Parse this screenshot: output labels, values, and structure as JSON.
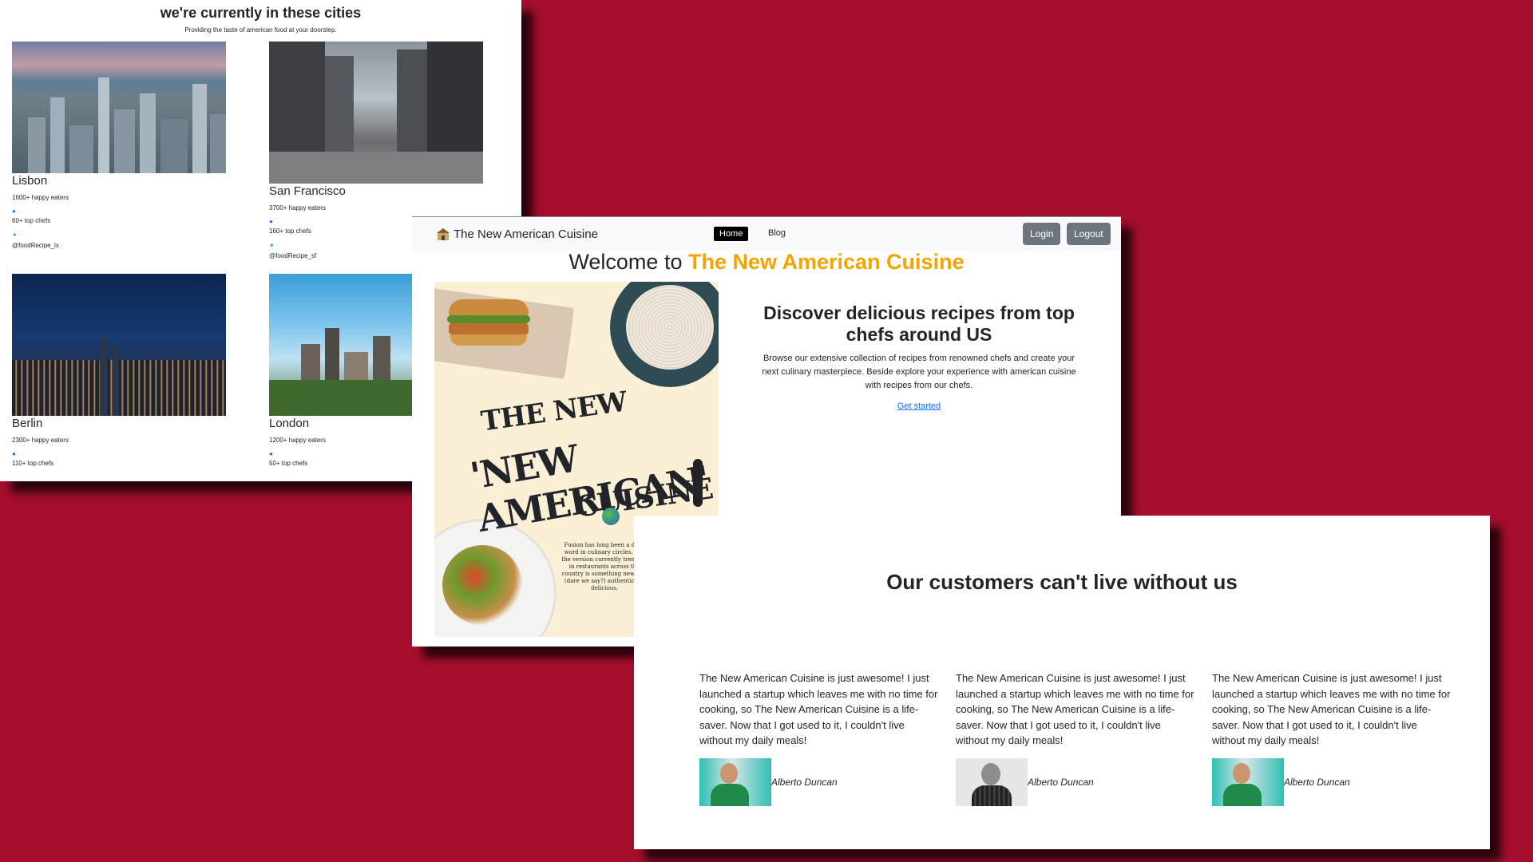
{
  "cities_section": {
    "title": "we're currently in these cities",
    "subtitle": "Providing the taste of american food at your doorstep.",
    "cities": [
      {
        "name": "Lisbon",
        "eaters": "1600+ happy eaters",
        "chefs": "60+ top chefs",
        "handle": "@foodRecipe_lx"
      },
      {
        "name": "San Francisco",
        "eaters": "3700+ happy eaters",
        "chefs": "160+ top chefs",
        "handle": "@foodRecipe_sf"
      },
      {
        "name": "Berlin",
        "eaters": "2300+ happy eaters",
        "chefs": "110+ top chefs"
      },
      {
        "name": "London",
        "eaters": "1200+ happy eaters",
        "chefs": "50+ top chefs"
      }
    ]
  },
  "navbar": {
    "brand": "The New American Cuisine",
    "links": [
      {
        "label": "Home",
        "active": true
      },
      {
        "label": "Blog",
        "active": false
      }
    ],
    "login": "Login",
    "logout": "Logout"
  },
  "hero": {
    "welcome_prefix": "Welcome to",
    "welcome_name": "The New American Cuisine",
    "heading": "Discover delicious recipes from top chefs around US",
    "body": "Browse our extensive collection of recipes from renowned chefs and create your next culinary masterpiece. Beside explore your experience with american cuisine with recipes from our chefs.",
    "cta": "Get started",
    "poster": {
      "line1": "THE NEW",
      "line2": "'NEW AMERICAN'",
      "line3": "CUISINE",
      "blurb": "Fusion has long been a dirty word in culinary circles. But the version currently trending in restaurants across the country is something new and (dare we say?) authentically delicious."
    }
  },
  "testimonials": {
    "heading": "Our customers can't live without us",
    "items": [
      {
        "quote": "The New American Cuisine is just awesome! I just launched a startup which leaves me with no time for cooking, so The New American Cuisine is a life-saver. Now that I got used to it, I couldn't live without my daily meals!",
        "author": "Alberto Duncan"
      },
      {
        "quote": "The New American Cuisine is just awesome! I just launched a startup which leaves me with no time for cooking, so The New American Cuisine is a life-saver. Now that I got used to it, I couldn't live without my daily meals!",
        "author": "Alberto Duncan"
      },
      {
        "quote": "The New American Cuisine is just awesome! I just launched a startup which leaves me with no time for cooking, so The New American Cuisine is a life-saver. Now that I got used to it, I couldn't live without my daily meals!",
        "author": "Alberto Duncan"
      }
    ]
  },
  "colors": {
    "background": "#a50e2d",
    "accent": "#f5a300",
    "link": "#0d6efd",
    "button_gray": "#6c757d"
  }
}
